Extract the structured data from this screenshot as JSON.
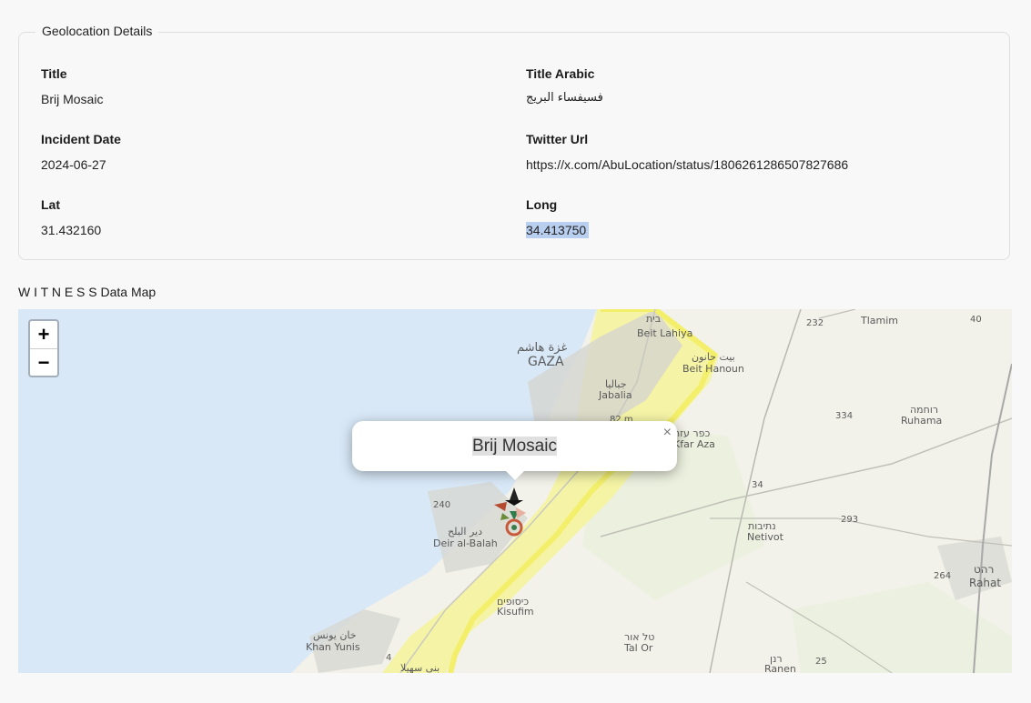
{
  "details": {
    "legend": "Geolocation Details",
    "title_label": "Title",
    "title_value": "Brij Mosaic",
    "title_ar_label": "Title Arabic",
    "title_ar_value": "فسيفساء البريج",
    "date_label": "Incident Date",
    "date_value": "2024-06-27",
    "twitter_label": "Twitter Url",
    "twitter_value": "https://x.com/AbuLocation/status/1806261286507827686",
    "lat_label": "Lat",
    "lat_value": "31.432160",
    "long_label": "Long",
    "long_value": "34.413750"
  },
  "map": {
    "title": "W I T N E S S Data Map",
    "zoom_in": "+",
    "zoom_out": "−",
    "popup_text": "Brij Mosaic",
    "popup_close": "×",
    "place_labels": {
      "beit_lahiya_he": "בית",
      "beit_lahiya": "Beit Lahiya",
      "beit_hanoun_ar": "بيت حانون",
      "beit_hanoun": "Beit Hanoun",
      "gaza_ar": "غزة هاشم",
      "gaza": "GAZA",
      "jabalia_ar": "جباليا",
      "jabalia": "Jabalia",
      "elevation": "82 m",
      "tlamim": "Tlamim",
      "ruhama_he": "רוחמה",
      "ruhama": "Ruhama",
      "kfar_aza_he": "כפר עזה",
      "kfar_aza": "Kfar Aza",
      "netivot_he": "נתיבות",
      "netivot": "Netivot",
      "rahat_he": "רהט",
      "rahat": "Rahat",
      "deir_ar": "دير البلح",
      "deir": "Deir al-Balah",
      "kisufim_he": "כיסופים",
      "kisufim": "Kisufim",
      "khan_ar": "خان يونس",
      "khan": "Khan Yunis",
      "tal_or_he": "טל אור",
      "tal_or": "Tal Or",
      "ranen_he": "רנן",
      "ranen": "Ranen",
      "bani_ar": "بني سهيلا"
    },
    "road_labels": {
      "r232": "232",
      "r40": "40",
      "r334": "334",
      "r34": "34",
      "r293": "293",
      "r264": "264",
      "r25": "25",
      "r4": "4",
      "r240": "240"
    },
    "colors": {
      "sea": "#d8e8f7",
      "land": "#f2f2ea",
      "strip": "#f6f59a",
      "border": "#f3ef6a"
    }
  }
}
